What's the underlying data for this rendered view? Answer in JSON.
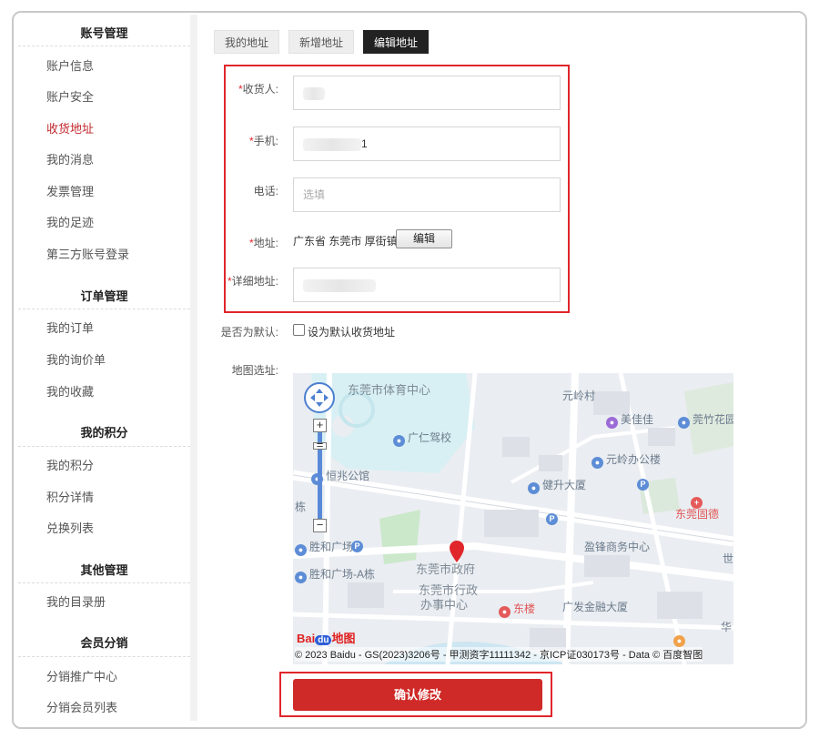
{
  "sidebar": {
    "sections": [
      {
        "title": "账号管理",
        "items": [
          "账户信息",
          "账户安全",
          "收货地址",
          "我的消息",
          "发票管理",
          "我的足迹",
          "第三方账号登录"
        ]
      },
      {
        "title": "订单管理",
        "items": [
          "我的订单",
          "我的询价单",
          "我的收藏"
        ]
      },
      {
        "title": "我的积分",
        "items": [
          "我的积分",
          "积分详情",
          "兑换列表"
        ]
      },
      {
        "title": "其他管理",
        "items": [
          "我的目录册"
        ]
      },
      {
        "title": "会员分销",
        "items": [
          "分销推广中心",
          "分销会员列表"
        ]
      }
    ],
    "active_item": "收货地址"
  },
  "tabs": [
    "我的地址",
    "新增地址",
    "编辑地址"
  ],
  "active_tab": "编辑地址",
  "form": {
    "required_mark": "*",
    "receiver_label": "收货人:",
    "mobile_label": "手机:",
    "mobile_value_tail": "1",
    "phone_label": "电话:",
    "phone_placeholder": "选填",
    "address_label": "地址:",
    "address_value": "广东省 东莞市 厚街镇",
    "edit_button": "编辑",
    "detail_label": "详细地址:",
    "default_label": "是否为默认:",
    "default_checkbox_label": "设为默认收货地址",
    "map_label": "地图选址:"
  },
  "map": {
    "places": [
      "东莞市体育中心",
      "元岭村",
      "美佳佳",
      "莞竹花园",
      "广仁驾校",
      "元岭办公楼",
      "恒兆公馆",
      "健升大厦",
      "东莞固德",
      "胜和广场",
      "盈锋商务中心",
      "胜和广场-A栋",
      "东莞市政府",
      "东莞市行政",
      "办事中心",
      "东楼",
      "广发金融大厦",
      "华",
      "世",
      "栋"
    ],
    "logo": "Bai",
    "logo_du": "du",
    "logo_suffix": "地图",
    "copyright": "© 2023 Baidu - GS(2023)3206号 - 甲测资字11111342 - 京ICP证030173号 - Data © 百度智图"
  },
  "submit_button": "确认修改",
  "colors": {
    "accent_red": "#e0262b",
    "button_red": "#cf2a27",
    "active_tab": "#222222"
  }
}
